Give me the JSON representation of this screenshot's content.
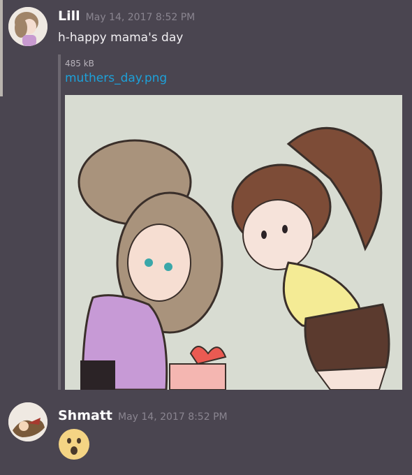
{
  "messages": [
    {
      "username": "Lill",
      "timestamp": "May 14, 2017 8:52 PM",
      "text": "h-happy mama's day",
      "attachment": {
        "size": "485 kB",
        "filename": "muthers_day.png"
      }
    },
    {
      "username": "Shmatt",
      "timestamp": "May 14, 2017 8:52 PM",
      "reaction_icon": "surprised-face-emoji"
    }
  ],
  "colors": {
    "background": "#4a4550",
    "link": "#1da1d9",
    "timestamp": "#8a8590"
  }
}
